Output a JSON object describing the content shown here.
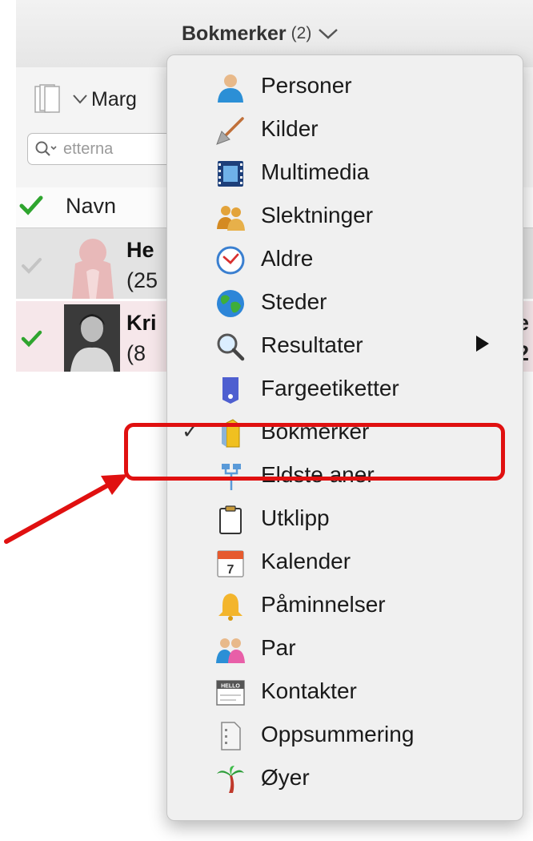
{
  "header": {
    "title": "Bokmerker",
    "count": "(2)"
  },
  "toolbar": {
    "margin_label": "Marg",
    "search_placeholder": "etterna"
  },
  "table": {
    "column_header": "Navn",
    "rows": [
      {
        "name": "He",
        "sub": "(25",
        "tail": "."
      },
      {
        "name": "Kri",
        "sub": "(8",
        "tail": "e",
        "tail2": "2"
      }
    ]
  },
  "menu": {
    "items": [
      {
        "label": "Personer",
        "icon": "person-icon"
      },
      {
        "label": "Kilder",
        "icon": "shovel-icon"
      },
      {
        "label": "Multimedia",
        "icon": "film-icon"
      },
      {
        "label": "Slektninger",
        "icon": "relatives-icon"
      },
      {
        "label": "Aldre",
        "icon": "clock-icon"
      },
      {
        "label": "Steder",
        "icon": "globe-icon"
      },
      {
        "label": "Resultater",
        "icon": "magnifier-icon",
        "submenu": true
      },
      {
        "label": "Fargeetiketter",
        "icon": "color-label-icon"
      },
      {
        "label": "Bokmerker",
        "icon": "bookmark-icon",
        "checked": true,
        "check": "✓"
      },
      {
        "label": "Eldste aner",
        "icon": "ancestors-icon"
      },
      {
        "label": "Utklipp",
        "icon": "clipboard-icon"
      },
      {
        "label": "Kalender",
        "icon": "calendar-icon",
        "icon_text": "7"
      },
      {
        "label": "Påminnelser",
        "icon": "bell-icon"
      },
      {
        "label": "Par",
        "icon": "couple-icon"
      },
      {
        "label": "Kontakter",
        "icon": "contact-card-icon",
        "icon_text": "HELLO"
      },
      {
        "label": "Oppsummering",
        "icon": "summary-icon"
      },
      {
        "label": "Øyer",
        "icon": "palm-tree-icon"
      }
    ]
  },
  "colors": {
    "highlight": "#e01010",
    "check_green": "#2fa52f",
    "row_selected": "#f6e7ea"
  }
}
